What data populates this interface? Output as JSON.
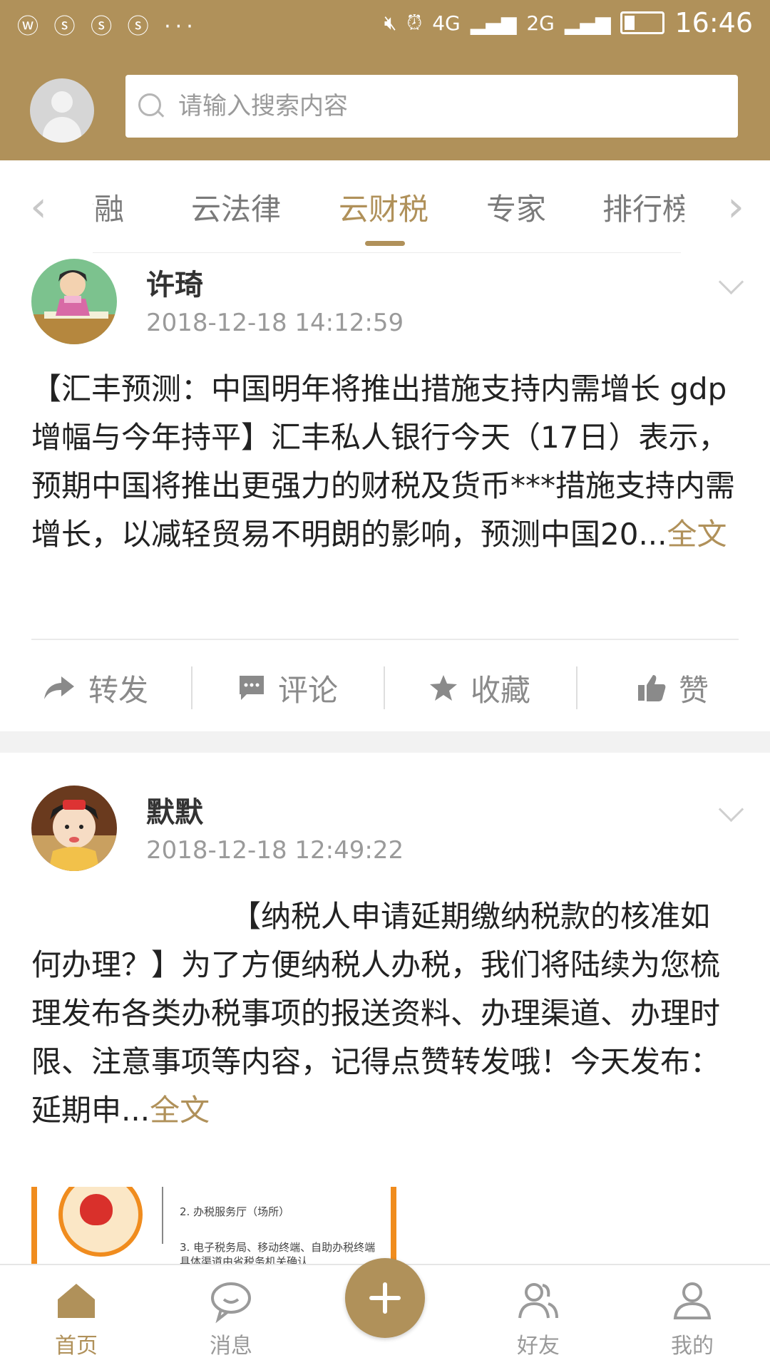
{
  "status_bar": {
    "left_icons": "ⓦ ⓢ ⓢ ⓢ ···",
    "network_1": "4G",
    "network_2": "2G",
    "time": "16:46"
  },
  "search": {
    "placeholder": "请输入搜索内容"
  },
  "tabs": [
    {
      "label": "金融",
      "active": false
    },
    {
      "label": "云法律",
      "active": false
    },
    {
      "label": "云财税",
      "active": true
    },
    {
      "label": "专家",
      "active": false
    },
    {
      "label": "排行榜",
      "active": false
    }
  ],
  "posts": [
    {
      "author": "许琦",
      "time": "2018-12-18 14:12:59",
      "text": "【汇丰预测：中国明年将推出措施支持内需增长 gdp增幅与今年持平】汇丰私人银行今天（17日）表示，预期中国将推出更强力的财税及货币***措施支持内需增长，以减轻贸易不明朗的影响，预测中国20...",
      "full_link": "全文"
    },
    {
      "author": "默默",
      "time": "2018-12-18 12:49:22",
      "text": "【纳税人申请延期缴纳税款的核准如何办理？】为了方便纳税人办税，我们将陆续为您梳理发布各类办税事项的报送资料、办理渠道、办理时限、注意事项等内容，记得点赞转发哦！今天发布：延期申...",
      "full_link": "全文",
      "image_lines": [
        "2. 办税服务厅（场所）",
        "3. 电子税务局、移动终端、自助办税终端",
        "具体渠道由省税务机关确认"
      ]
    }
  ],
  "actions": {
    "share": "转发",
    "comment": "评论",
    "favorite": "收藏",
    "like": "赞"
  },
  "bottom_nav": [
    {
      "label": "首页",
      "icon": "home-icon",
      "active": true
    },
    {
      "label": "消息",
      "icon": "message-icon",
      "active": false
    },
    {
      "label": "",
      "icon": "plus-icon",
      "active": false
    },
    {
      "label": "好友",
      "icon": "friends-icon",
      "active": false
    },
    {
      "label": "我的",
      "icon": "profile-icon",
      "active": false
    }
  ],
  "colors": {
    "brand": "#b0915a",
    "link": "#b0915a",
    "thumb_accent": "#f08c1e"
  }
}
